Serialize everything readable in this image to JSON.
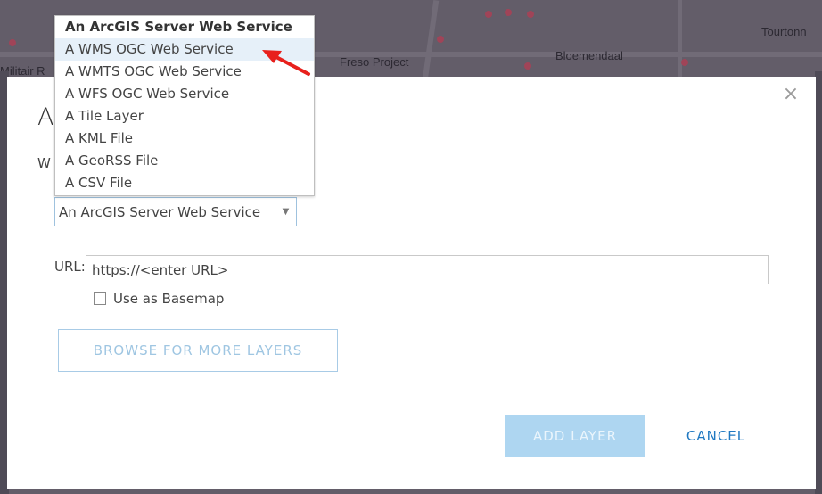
{
  "map": {
    "places": [
      "Militair R",
      "Freso Project",
      "Bloemendaal",
      "Tourtonn"
    ]
  },
  "dialog": {
    "title": "A",
    "question": "W",
    "close_symbol": "×",
    "layer_type_select": {
      "selected": "An ArcGIS Server Web Service",
      "arrow_symbol": "▼",
      "options": [
        "An ArcGIS Server Web Service",
        "A WMS OGC Web Service",
        "A WMTS OGC Web Service",
        "A WFS OGC Web Service",
        "A Tile Layer",
        "A KML File",
        "A GeoRSS File",
        "A CSV File"
      ],
      "highlighted_option": "A WMS OGC Web Service"
    },
    "url": {
      "label": "URL:",
      "value": "https://<enter URL>"
    },
    "basemap_checkbox": {
      "label": "Use as Basemap",
      "checked": false
    },
    "browse_button": "BROWSE FOR MORE LAYERS",
    "add_button": "ADD LAYER",
    "cancel_button": "CANCEL"
  },
  "colors": {
    "primary_link": "#1f78c1",
    "disabled_button": "#aed6f1",
    "annotation_arrow": "#e8201c",
    "highlight_row": "#e6f0f9"
  }
}
